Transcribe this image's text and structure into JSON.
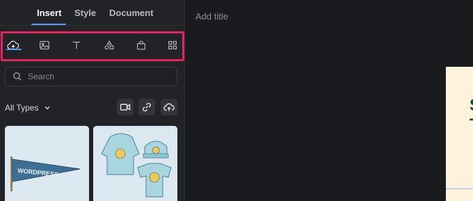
{
  "tabs": [
    {
      "label": "Insert",
      "active": true
    },
    {
      "label": "Style",
      "active": false
    },
    {
      "label": "Document",
      "active": false
    }
  ],
  "insert_icons": [
    {
      "name": "upload-icon",
      "active": true
    },
    {
      "name": "image-icon",
      "active": false
    },
    {
      "name": "text-icon",
      "active": false
    },
    {
      "name": "shapes-icon",
      "active": false
    },
    {
      "name": "shopping-bag-icon",
      "active": false
    },
    {
      "name": "grid-icon",
      "active": false
    }
  ],
  "search": {
    "placeholder": "Search",
    "value": ""
  },
  "filter": {
    "label": "All Types"
  },
  "media_buttons": [
    "video-icon",
    "link-icon",
    "upload-cloud-icon"
  ],
  "media_items": [
    {
      "name": "wordpress-pennant",
      "text": "WORDPRESS"
    },
    {
      "name": "merch-collection"
    }
  ],
  "canvas": {
    "title_placeholder": "Add title",
    "card_text": "S\nT"
  },
  "colors": {
    "accent": "#5a9cf8",
    "highlight": "#e3245e",
    "panel": "#222326",
    "background": "#1a1b1e"
  }
}
